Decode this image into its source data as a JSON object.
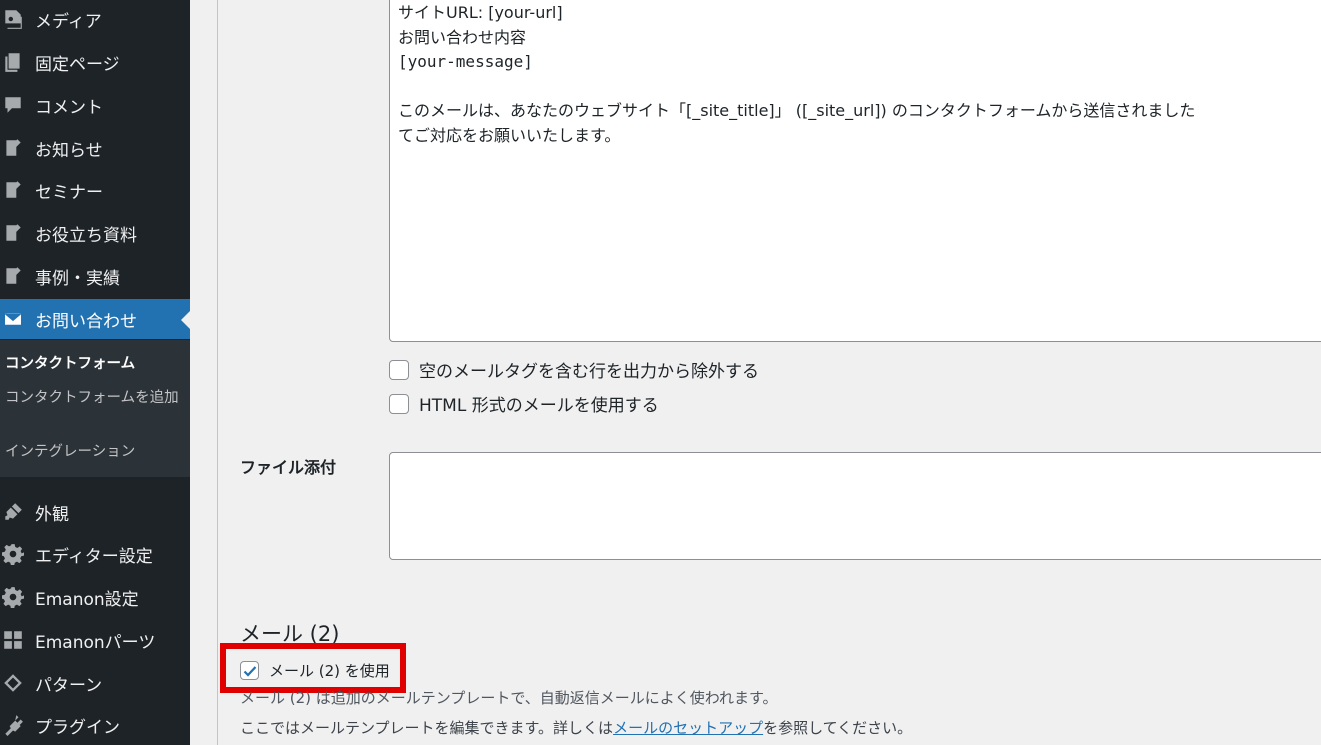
{
  "sidebar": {
    "items": [
      {
        "label": "メディア",
        "icon": "media-icon"
      },
      {
        "label": "固定ページ",
        "icon": "pages-icon"
      },
      {
        "label": "コメント",
        "icon": "comments-icon"
      },
      {
        "label": "お知らせ",
        "icon": "post-icon"
      },
      {
        "label": "セミナー",
        "icon": "post-icon"
      },
      {
        "label": "お役立ち資料",
        "icon": "post-icon"
      },
      {
        "label": "事例・実績",
        "icon": "post-icon"
      },
      {
        "label": "お問い合わせ",
        "icon": "mail-icon"
      },
      {
        "label": "外観",
        "icon": "appearance-icon"
      },
      {
        "label": "エディター設定",
        "icon": "gear-icon"
      },
      {
        "label": "Emanon設定",
        "icon": "gear-icon"
      },
      {
        "label": "Emanonパーツ",
        "icon": "grid-icon"
      },
      {
        "label": "パターン",
        "icon": "pattern-icon"
      },
      {
        "label": "プラグイン",
        "icon": "plugin-icon"
      }
    ],
    "submenu": [
      {
        "label": "コンタクトフォーム"
      },
      {
        "label": "コンタクトフォームを追加"
      },
      {
        "label": "インテグレーション"
      }
    ]
  },
  "mail_body": {
    "lines": [
      "サイトURL: [your-url]",
      "お問い合わせ内容",
      "[your-message]",
      "",
      "このメールは、あなたのウェブサイト「[_site_title]」 ([_site_url]) のコンタクトフォームから送信されました",
      "てご対応をお願いいたします。"
    ]
  },
  "options": {
    "exclude_blank": "空のメールタグを含む行を出力から除外する",
    "use_html": "HTML 形式のメールを使用する"
  },
  "attachments": {
    "label": "ファイル添付"
  },
  "mail2": {
    "heading": "メール (2)",
    "use_label": "メール (2) を使用",
    "desc1": "メール (2) は追加のメールテンプレートで、自動返信メールによく使われます。",
    "desc2_prefix": "ここではメールテンプレートを編集できます。詳しくは",
    "desc2_link": "メールのセットアップ",
    "desc2_suffix": "を参照してください。"
  },
  "colors": {
    "sidebar_bg": "#1d2327",
    "active": "#2271b1",
    "highlight": "#e00000"
  }
}
